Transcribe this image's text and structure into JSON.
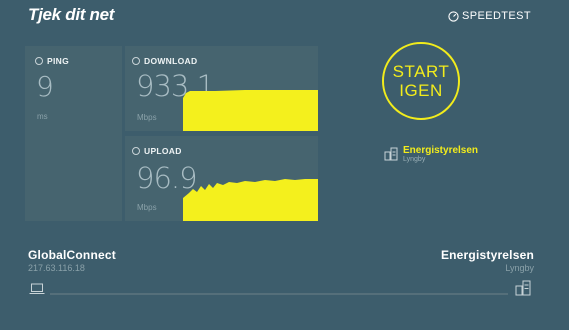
{
  "header": {
    "logo": "Tjek dit net",
    "speedtest_label": "SPEEDTEST"
  },
  "ping": {
    "label": "PING",
    "value": "9",
    "unit": "ms"
  },
  "download": {
    "label": "DOWNLOAD",
    "value": "933.1",
    "unit": "Mbps"
  },
  "upload": {
    "label": "UPLOAD",
    "value": "96.9",
    "unit": "Mbps"
  },
  "start_button": {
    "line1": "START",
    "line2": "IGEN"
  },
  "server": {
    "name": "Energistyrelsen",
    "city": "Lyngby"
  },
  "client": {
    "name": "GlobalConnect",
    "ip": "217.63.116.18"
  },
  "colors": {
    "accent": "#f2ec1c",
    "background": "#3d5d6c",
    "tile": "#46646f"
  }
}
